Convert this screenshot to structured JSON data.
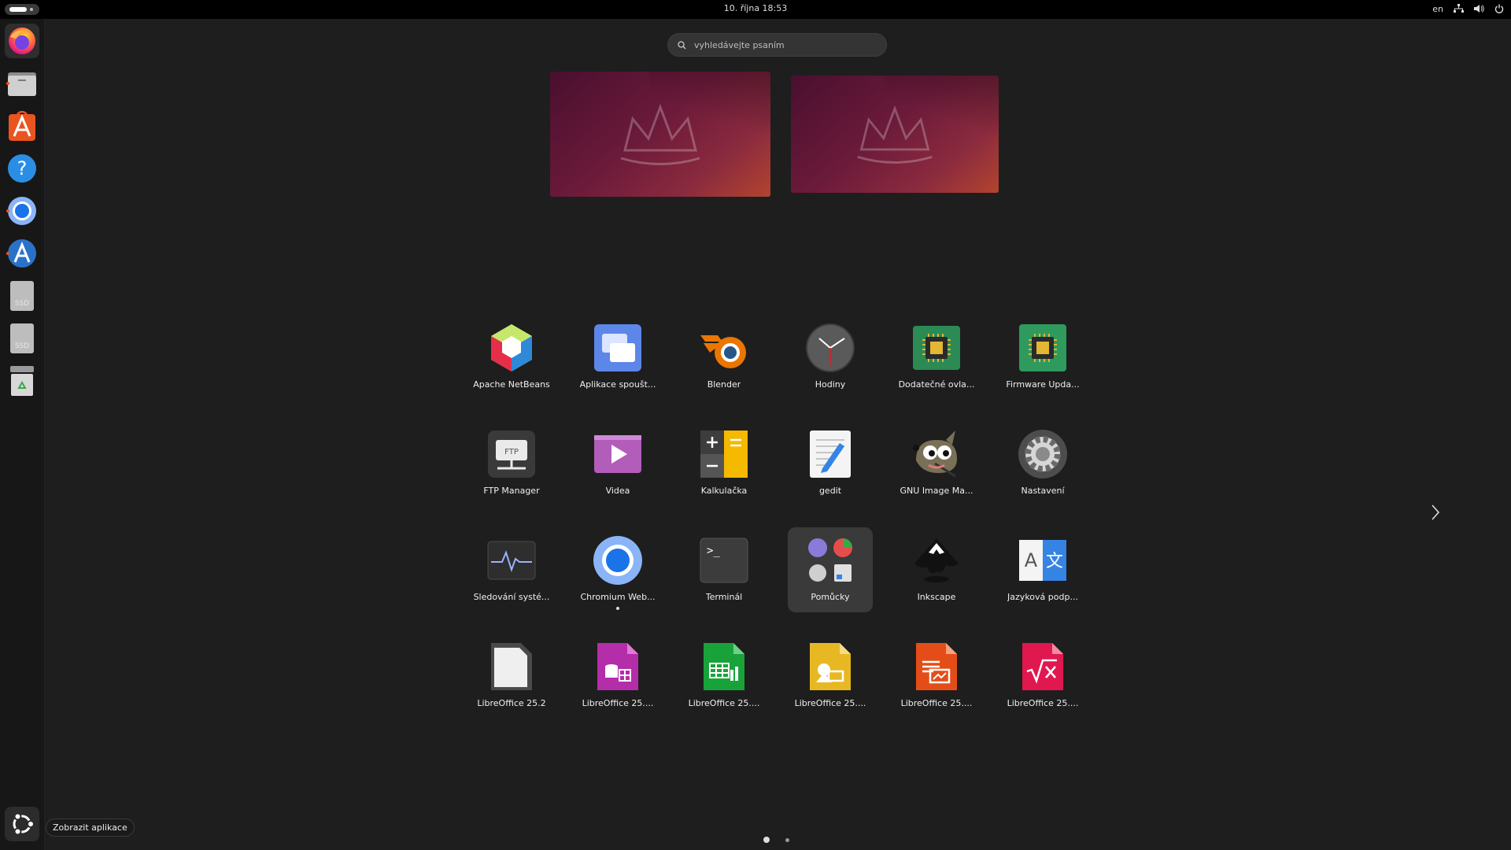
{
  "topbar": {
    "datetime": "10. října  18:53",
    "keyboard_layout": "en"
  },
  "search": {
    "placeholder": "vyhledávejte psaním"
  },
  "dock": {
    "show_apps_tooltip": "Zobrazit aplikace",
    "drive_label": "SSD"
  },
  "apps": [
    {
      "label": "Apache NetBeans"
    },
    {
      "label": "Aplikace spoušt..."
    },
    {
      "label": "Blender"
    },
    {
      "label": "Hodiny"
    },
    {
      "label": "Dodatečné ovla..."
    },
    {
      "label": "Firmware Upda..."
    },
    {
      "label": "FTP Manager"
    },
    {
      "label": "Videa"
    },
    {
      "label": "Kalkulačka"
    },
    {
      "label": "gedit"
    },
    {
      "label": "GNU Image Ma..."
    },
    {
      "label": "Nastavení"
    },
    {
      "label": "Sledování systé..."
    },
    {
      "label": "Chromium Web..."
    },
    {
      "label": "Terminál"
    },
    {
      "label": "Pomůcky"
    },
    {
      "label": "Inkscape"
    },
    {
      "label": "Jazyková podp..."
    },
    {
      "label": "LibreOffice 25.2"
    },
    {
      "label": "LibreOffice 25...."
    },
    {
      "label": "LibreOffice 25...."
    },
    {
      "label": "LibreOffice 25...."
    },
    {
      "label": "LibreOffice 25...."
    },
    {
      "label": "LibreOffice 25...."
    }
  ],
  "icon_labels": {
    "ftp": "FTP",
    "terminal_prompt": ">_",
    "lang_a": "A",
    "lang_b": "文"
  },
  "pagination": {
    "current": 1,
    "total": 2
  }
}
